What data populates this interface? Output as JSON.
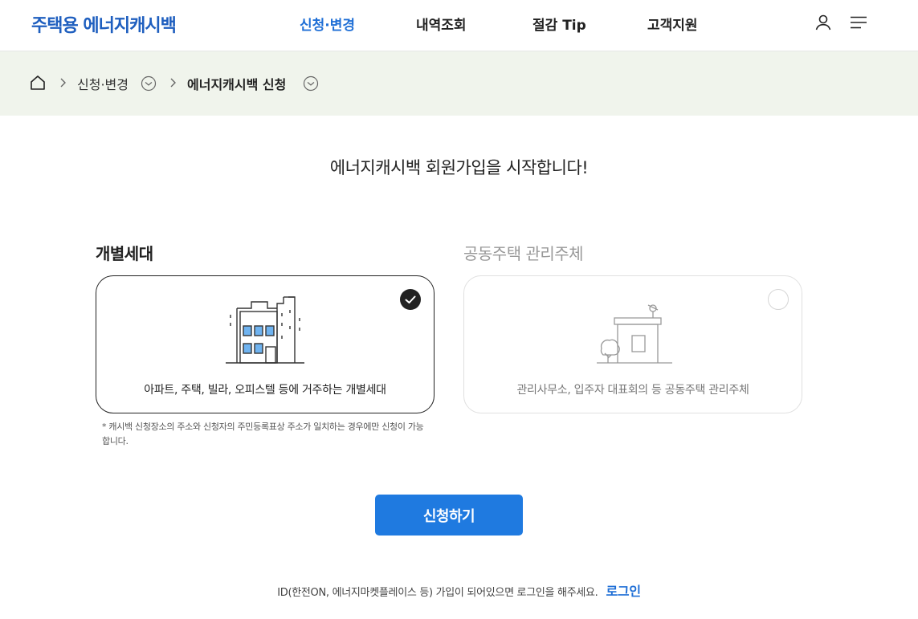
{
  "header": {
    "logo": "주택용 에너지캐시백",
    "nav": [
      {
        "label": "신청·변경",
        "active": true
      },
      {
        "label": "내역조회",
        "active": false
      },
      {
        "label": "절감 Tip",
        "active": false
      },
      {
        "label": "고객지원",
        "active": false
      }
    ],
    "icons": [
      "user-icon",
      "menu-icon"
    ]
  },
  "breadcrumb": {
    "home_icon": "home-icon",
    "items": [
      "신청·변경",
      "에너지캐시백 신청"
    ]
  },
  "main": {
    "title": "에너지캐시백 회원가입을 시작합니다!",
    "options": [
      {
        "heading": "개별세대",
        "description": "아파트, 주택, 빌라, 오피스텔 등에 거주하는 개별세대",
        "selected": true,
        "icon": "apartment-building-icon"
      },
      {
        "heading": "공동주택 관리주체",
        "description": "관리사무소, 입주자 대표회의 등 공동주택 관리주체",
        "selected": false,
        "icon": "management-office-icon"
      }
    ],
    "note": "* 캐시백 신청장소의 주소와 신청자의 주민등록표상 주소가 일치하는 경우에만 신청이 가능합니다.",
    "apply_label": "신청하기"
  },
  "footer": {
    "message": "ID(한전ON, 에너지마켓플레이스 등) 가입이 되어있으면 로그인을 해주세요.",
    "login_label": "로그인"
  },
  "colors": {
    "brand": "#1f5fbf",
    "accent": "#1f7ae0",
    "breadcrumb_bg": "#f0f4ec"
  }
}
